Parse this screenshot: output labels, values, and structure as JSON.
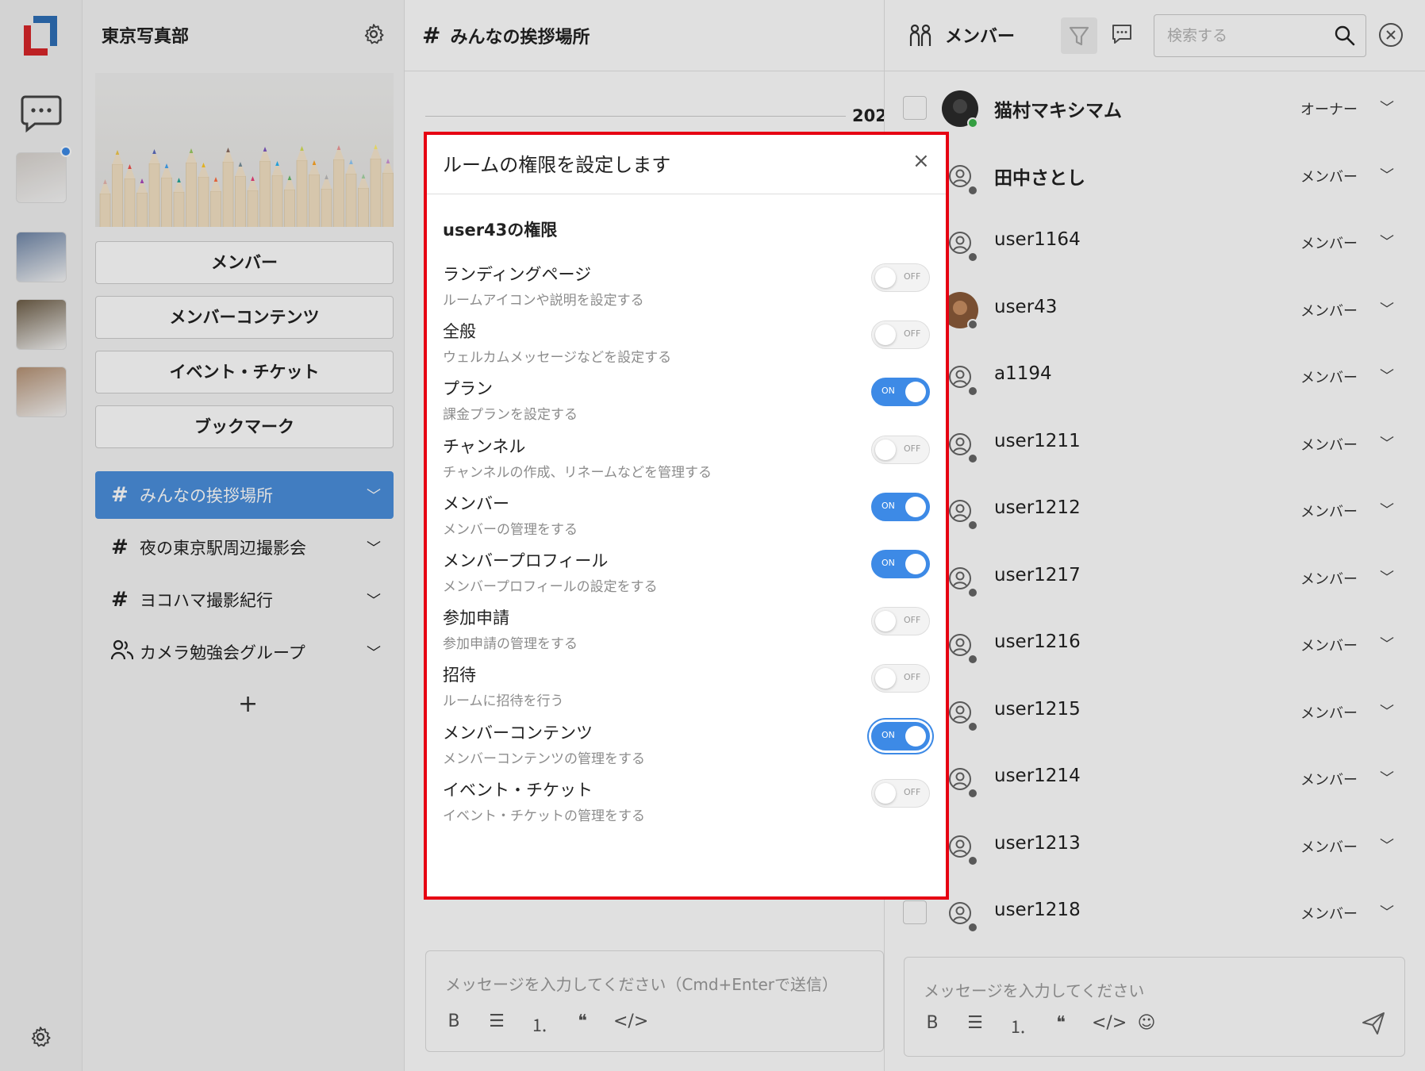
{
  "rail": {
    "items": [
      {
        "name": "direct-messages"
      },
      {
        "name": "room-thumbnail-1",
        "color": "#d9d4cf"
      },
      {
        "name": "room-thumbnail-2",
        "color": "#6f86a8"
      },
      {
        "name": "room-thumbnail-3",
        "color": "#6d5d46"
      },
      {
        "name": "room-thumbnail-4",
        "color": "#b59173"
      }
    ],
    "notification_color": "#3d8ae6"
  },
  "sidebar": {
    "room_name": "東京写真部",
    "nav_buttons": [
      "メンバー",
      "メンバーコンテンツ",
      "イベント・チケット",
      "ブックマーク"
    ],
    "channels": [
      {
        "label": "みんなの挨拶場所",
        "icon": "hash",
        "active": true
      },
      {
        "label": "夜の東京駅周辺撮影会",
        "icon": "hash",
        "active": false
      },
      {
        "label": "ヨコハマ撮影紀行",
        "icon": "hash",
        "active": false
      },
      {
        "label": "カメラ勉強会グループ",
        "icon": "group",
        "active": false
      }
    ],
    "add_label": "+"
  },
  "main": {
    "channel_title": "みんなの挨拶場所",
    "date_label": "202",
    "composer_placeholder": "メッセージを入力してください（Cmd+Enterで送信）"
  },
  "members_panel": {
    "title": "メンバー",
    "search_placeholder": "検索する",
    "members": [
      {
        "name": "猫村マキシマム",
        "role": "オーナー",
        "bold": true,
        "online": true,
        "avatar": "photo"
      },
      {
        "name": "田中さとし",
        "role": "メンバー",
        "bold": true,
        "online": false,
        "avatar": "default"
      },
      {
        "name": "user1164",
        "role": "メンバー",
        "bold": false,
        "online": false,
        "avatar": "default"
      },
      {
        "name": "user43",
        "role": "メンバー",
        "bold": false,
        "online": false,
        "avatar": "photo"
      },
      {
        "name": "a1194",
        "role": "メンバー",
        "bold": false,
        "online": false,
        "avatar": "default"
      },
      {
        "name": "user1211",
        "role": "メンバー",
        "bold": false,
        "online": false,
        "avatar": "default"
      },
      {
        "name": "user1212",
        "role": "メンバー",
        "bold": false,
        "online": false,
        "avatar": "default"
      },
      {
        "name": "user1217",
        "role": "メンバー",
        "bold": false,
        "online": false,
        "avatar": "default"
      },
      {
        "name": "user1216",
        "role": "メンバー",
        "bold": false,
        "online": false,
        "avatar": "default"
      },
      {
        "name": "user1215",
        "role": "メンバー",
        "bold": false,
        "online": false,
        "avatar": "default"
      },
      {
        "name": "user1214",
        "role": "メンバー",
        "bold": false,
        "online": false,
        "avatar": "default"
      },
      {
        "name": "user1213",
        "role": "メンバー",
        "bold": false,
        "online": false,
        "avatar": "default"
      },
      {
        "name": "user1218",
        "role": "メンバー",
        "bold": false,
        "online": false,
        "avatar": "default"
      }
    ],
    "composer_placeholder": "メッセージを入力してください"
  },
  "modal": {
    "title": "ルームの権限を設定します",
    "close_label": "×",
    "heading": "user43の権限",
    "on_label": "ON",
    "off_label": "OFF",
    "permissions": [
      {
        "title": "ランディングページ",
        "desc": "ルームアイコンや説明を設定する",
        "on": false
      },
      {
        "title": "全般",
        "desc": "ウェルカムメッセージなどを設定する",
        "on": false
      },
      {
        "title": "プラン",
        "desc": "課金プランを設定する",
        "on": true
      },
      {
        "title": "チャンネル",
        "desc": "チャンネルの作成、リネームなどを管理する",
        "on": false
      },
      {
        "title": "メンバー",
        "desc": "メンバーの管理をする",
        "on": true
      },
      {
        "title": "メンバープロフィール",
        "desc": "メンバープロフィールの設定をする",
        "on": true
      },
      {
        "title": "参加申請",
        "desc": "参加申請の管理をする",
        "on": false
      },
      {
        "title": "招待",
        "desc": "ルームに招待を行う",
        "on": false
      },
      {
        "title": "メンバーコンテンツ",
        "desc": "メンバーコンテンツの管理をする",
        "on": true,
        "focused": true
      },
      {
        "title": "イベント・チケット",
        "desc": "イベント・チケットの管理をする",
        "on": false
      }
    ]
  },
  "colors": {
    "accent": "#3d8ae6",
    "active_channel": "#4a8fdc",
    "highlight_border": "#e60012",
    "online": "#3cb44b"
  }
}
